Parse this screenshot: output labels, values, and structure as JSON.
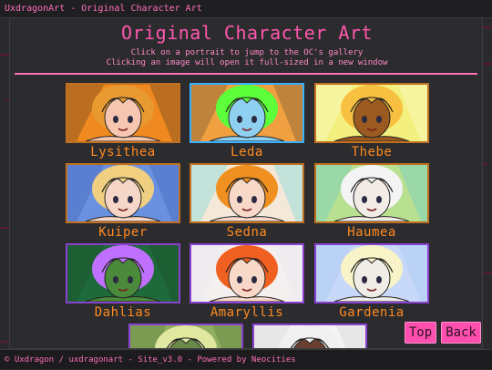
{
  "window": {
    "title": "UxdragonArt - Original Character Art"
  },
  "header": {
    "title": "Original Character Art",
    "line1": "Click on a portrait to jump to the OC's gallery",
    "line2": "Clicking an image will open it full-sized in a new window"
  },
  "gallery": [
    {
      "name": "Lysithea",
      "border": "#c07020",
      "bg": "#f08a20",
      "skin": "#f6c6b0",
      "hair": "#e89a30",
      "accent": "#1c1c1c"
    },
    {
      "name": "Leda",
      "border": "#3ab0ff",
      "bg": "#f0a040",
      "skin": "#8fd0f0",
      "hair": "#5cff3a",
      "accent": "#2a2a2a"
    },
    {
      "name": "Thebe",
      "border": "#c07020",
      "bg": "#f4f080",
      "skin": "#9a5a20",
      "hair": "#f8c040",
      "accent": "#ffffff"
    },
    {
      "name": "Kuiper",
      "border": "#c07020",
      "bg": "#6a90e0",
      "skin": "#f6d6c6",
      "hair": "#f0d080",
      "accent": "#2a4aa0"
    },
    {
      "name": "Sedna",
      "border": "#c07020",
      "bg": "#f4e8d8",
      "skin": "#f8d8c8",
      "hair": "#f09020",
      "accent": "#2ad0e0"
    },
    {
      "name": "Haumea",
      "border": "#c07020",
      "bg": "#b8e090",
      "skin": "#f2ece6",
      "hair": "#f4f4f4",
      "accent": "#40c0f0"
    },
    {
      "name": "Dahlias",
      "border": "#8a40d0",
      "bg": "#1e6a3a",
      "skin": "#4a8a3a",
      "hair": "#c070ff",
      "accent": "#1a3a20"
    },
    {
      "name": "Amaryllis",
      "border": "#8a40d0",
      "bg": "#f4f0f0",
      "skin": "#f8d8c8",
      "hair": "#f06020",
      "accent": "#e0e0f0"
    },
    {
      "name": "Gardenia",
      "border": "#8a40d0",
      "bg": "#c8d8f8",
      "skin": "#f0ece8",
      "hair": "#f8f4c8",
      "accent": "#90c0f0"
    },
    {
      "name": "",
      "border": "#8a40d0",
      "bg": "#90b060",
      "skin": "#6a8a4a",
      "hair": "#e0e8a0",
      "accent": "#3a5a2a"
    },
    {
      "name": "",
      "border": "#8a40d0",
      "bg": "#f4f4f4",
      "skin": "#6a4030",
      "hair": "#f0f0f0",
      "accent": "#c0c0c0"
    }
  ],
  "buttons": {
    "top": "Top",
    "back": "Back"
  },
  "footer": {
    "text": "© Uxdragon / uxdragonart - Site_v3.0 - Powered by Neocities"
  },
  "colors": {
    "accent": "#ff57b0",
    "caption": "#ff8a1f",
    "background": "#2a2a2c"
  }
}
